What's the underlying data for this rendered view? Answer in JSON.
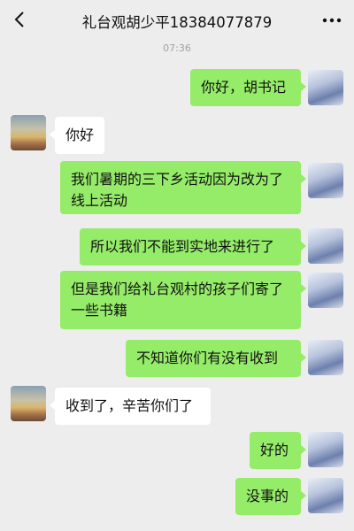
{
  "header": {
    "title": "礼台观胡少平18384077879",
    "back_icon": "chevron-left-icon",
    "more_icon": "more-dots-icon"
  },
  "timestamp": "07:36",
  "messages": [
    {
      "sender": "me",
      "text": "你好，胡书记"
    },
    {
      "sender": "other",
      "text": "你好"
    },
    {
      "sender": "me",
      "text": "我们暑期的三下乡活动因为改为了线上活动"
    },
    {
      "sender": "me",
      "text": "所以我们不能到实地来进行了"
    },
    {
      "sender": "me",
      "text": "但是我们给礼台观村的孩子们寄了一些书籍"
    },
    {
      "sender": "me",
      "text": "不知道你们有没有收到"
    },
    {
      "sender": "other",
      "text": "收到了，辛苦你们了"
    },
    {
      "sender": "me",
      "text": "好的"
    },
    {
      "sender": "me",
      "text": "没事的"
    }
  ],
  "colors": {
    "background": "#ededed",
    "my_bubble": "#95ec69",
    "their_bubble": "#ffffff"
  }
}
